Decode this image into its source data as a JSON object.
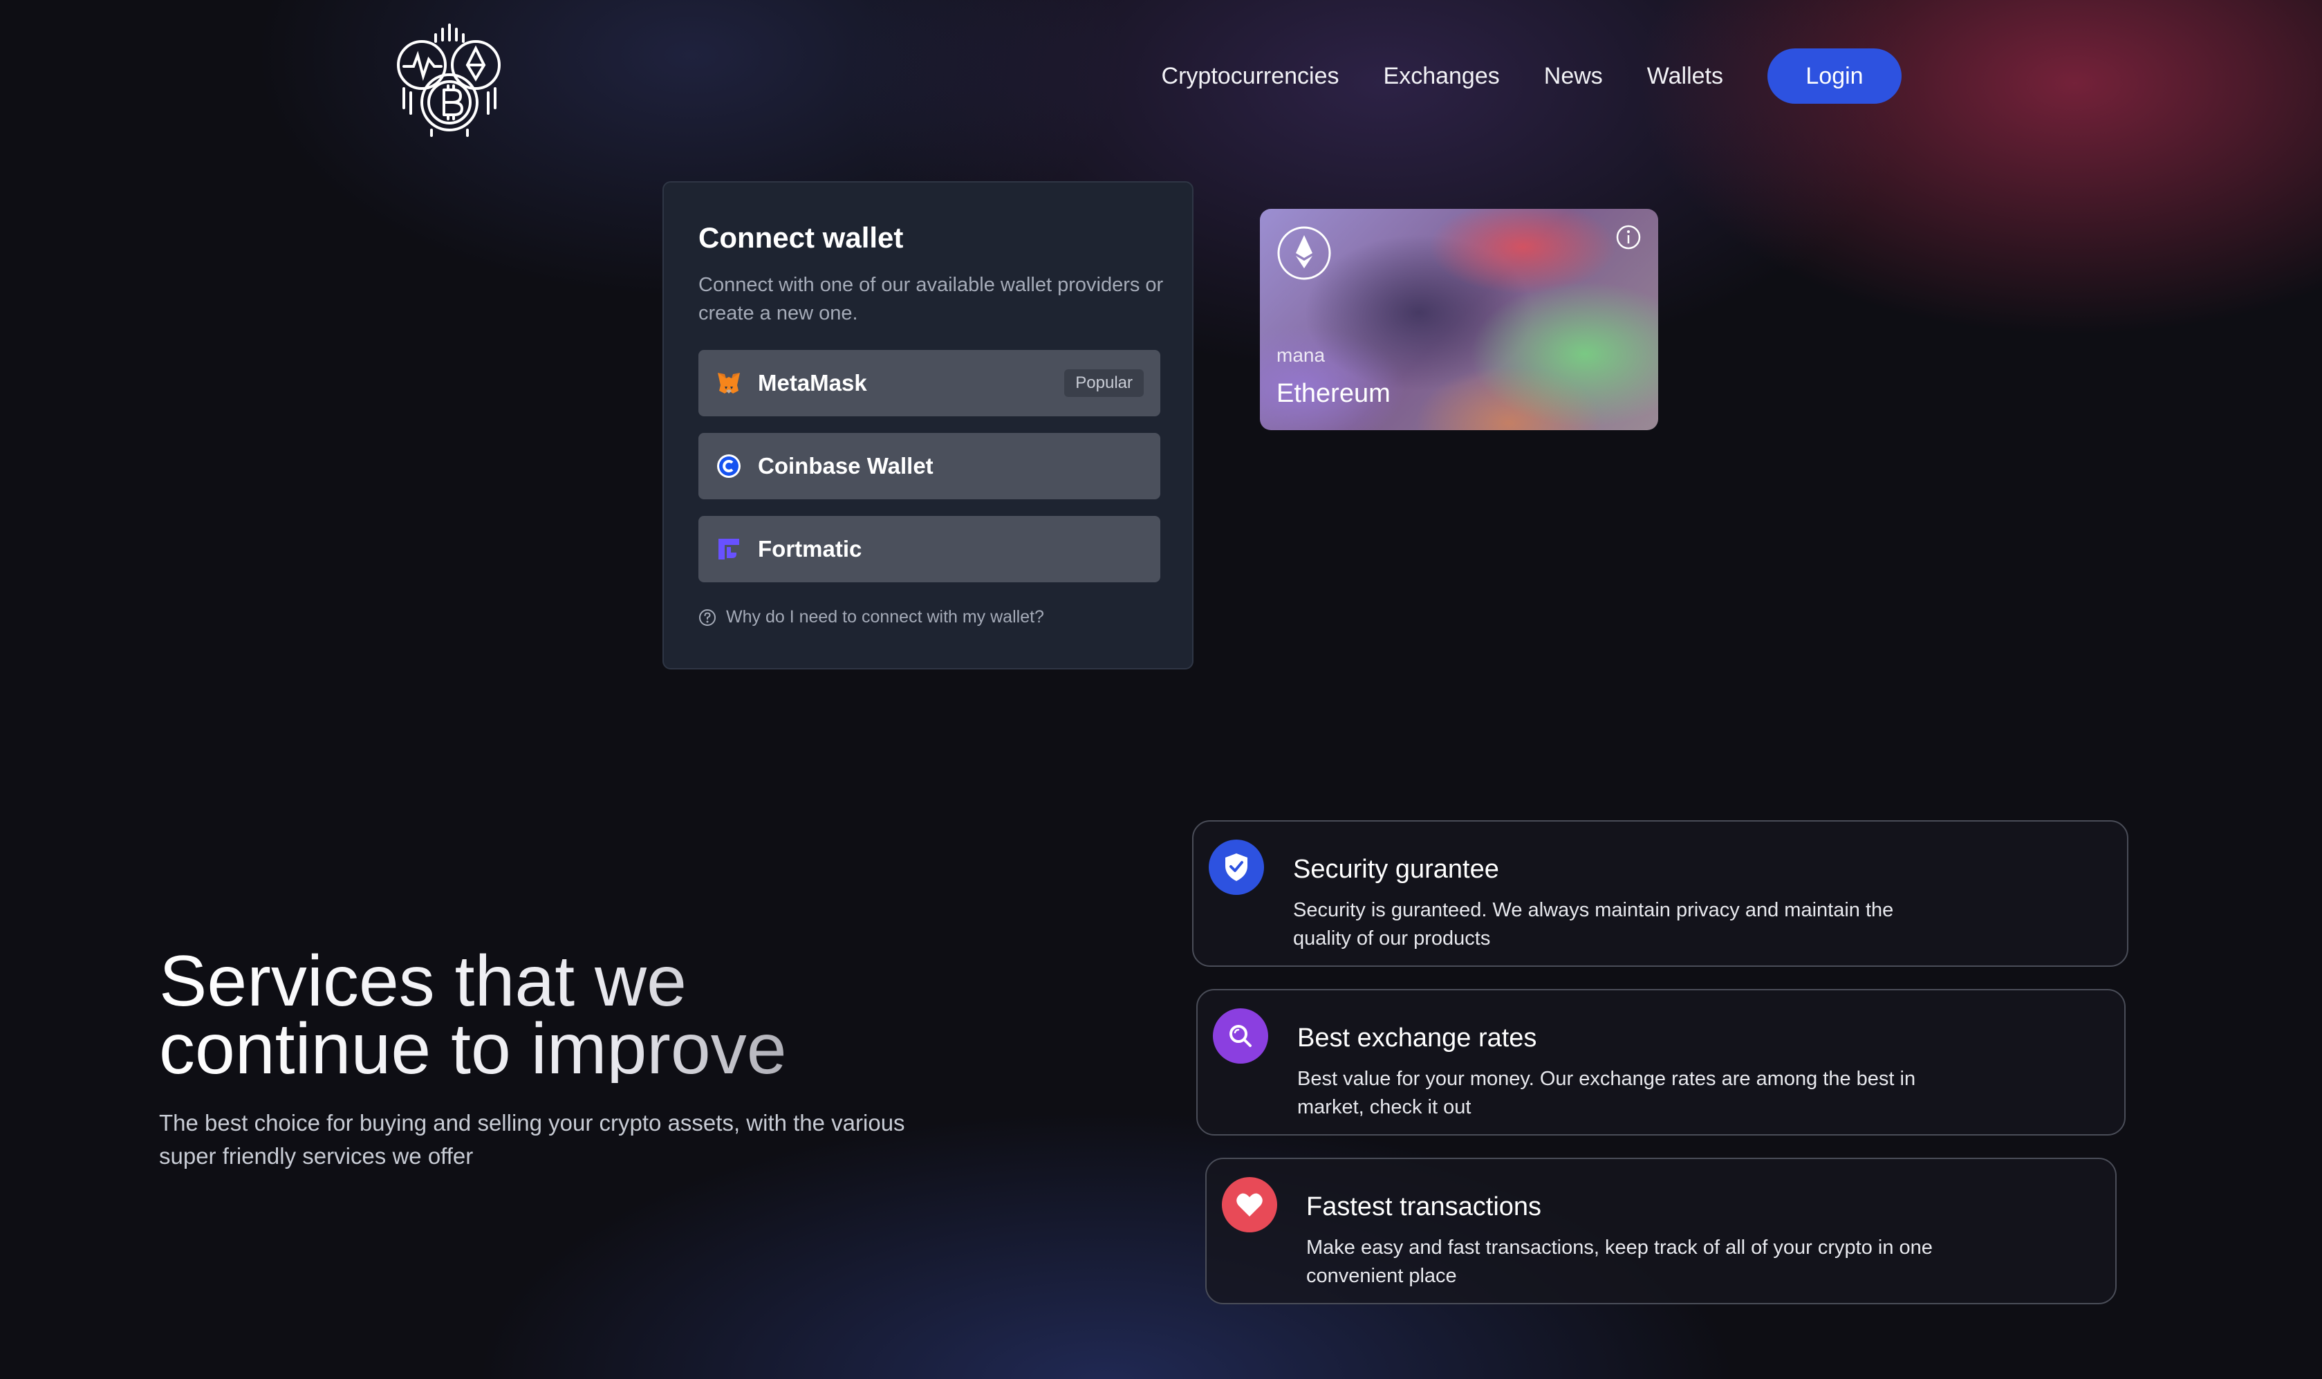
{
  "nav": {
    "links": [
      "Cryptocurrencies",
      "Exchanges",
      "News",
      "Wallets"
    ],
    "login_label": "Login"
  },
  "wallet": {
    "title": "Connect wallet",
    "description": "Connect with one of our available wallet providers or create a new one.",
    "providers": [
      {
        "label": "MetaMask",
        "badge": "Popular",
        "icon": "metamask-fox-icon"
      },
      {
        "label": "Coinbase Wallet",
        "icon": "coinbase-icon"
      },
      {
        "label": "Fortmatic",
        "icon": "fortmatic-icon"
      }
    ],
    "help": "Why do I need to connect with my wallet?"
  },
  "token_card": {
    "subtitle": "mana",
    "name": "Ethereum",
    "icon": "ethereum-icon"
  },
  "services": {
    "title_line1": "Services that we",
    "title_line2": "continue to improve",
    "description": "The best choice for buying and selling your crypto assets, with the various super friendly services we offer"
  },
  "features": [
    {
      "title": "Security gurantee",
      "description": "Security is guranteed. We always maintain privacy and maintain the quality of our products",
      "icon": "shield-check-icon",
      "color": "#2d52e0"
    },
    {
      "title": "Best exchange rates",
      "description": "Best value for your money. Our exchange rates are among the best in market, check it out",
      "icon": "search-icon",
      "color": "#8b3fe0"
    },
    {
      "title": "Fastest transactions",
      "description": "Make easy and fast transactions, keep track of all of your crypto in one convenient place",
      "icon": "heart-icon",
      "color": "#e84a57"
    }
  ],
  "colors": {
    "accent": "#2d52e0",
    "card_bg": "#1e2431",
    "provider_bg": "#4b505c"
  }
}
